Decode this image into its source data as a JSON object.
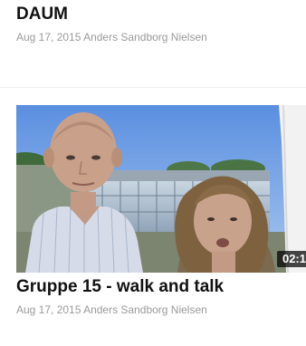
{
  "items": [
    {
      "title": "DAUM",
      "meta": "Aug 17, 2015 Anders Sandborg Nielsen"
    },
    {
      "title": "Gruppe 15 - walk and talk",
      "meta": "Aug 17, 2015 Anders Sandborg Nielsen",
      "duration": "02:1",
      "thumbnail_alt": "man-and-woman-selfie-outdoors"
    }
  ]
}
